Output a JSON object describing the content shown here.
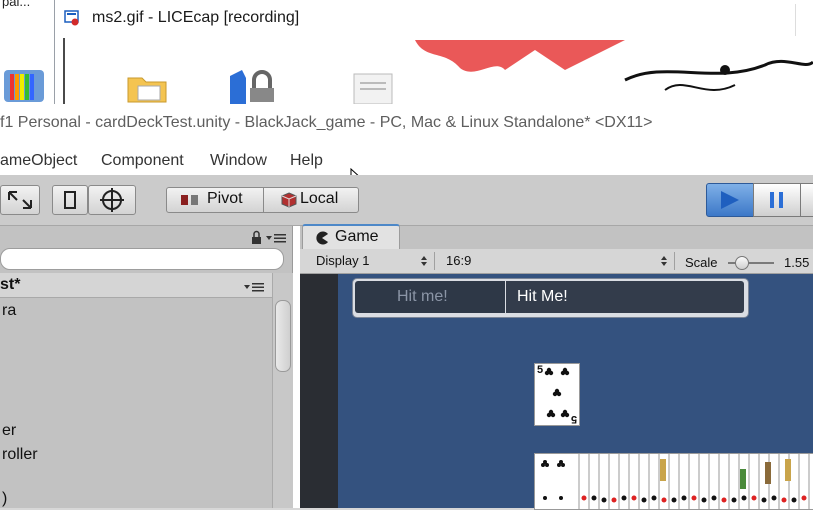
{
  "background_window": {
    "text": "pai..."
  },
  "licecap": {
    "title": "ms2.gif - LICEcap [recording]"
  },
  "unity": {
    "title": "f1 Personal - cardDeckTest.unity - BlackJack_game - PC, Mac & Linux Standalone* <DX11>",
    "menu": [
      "ameObject",
      "Component",
      "Window",
      "Help"
    ],
    "toolbar": {
      "pivot_label": "Pivot",
      "local_label": "Local"
    }
  },
  "hierarchy": {
    "header": "st*",
    "items": [
      "ra",
      "er",
      "roller",
      ")"
    ]
  },
  "game_view": {
    "tab_label": "Game",
    "display_label": "Display 1",
    "aspect_label": "16:9",
    "scale_label": "Scale",
    "scale_value": "1.55",
    "button_label_inactive": "Hit me!",
    "button_label_active": "Hit Me!",
    "card_rank": "5"
  },
  "colors": {
    "game_background": "#34527f",
    "play_button": "#3c78c8",
    "tab_accent": "#4d88c8"
  }
}
